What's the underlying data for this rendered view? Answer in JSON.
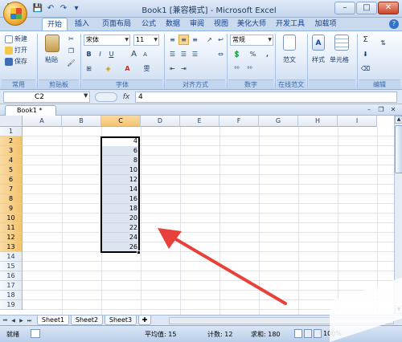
{
  "title": "Book1  [兼容模式] - Microsoft Excel",
  "window_controls": {
    "minimize": "–",
    "maximize": "□",
    "close": "✕"
  },
  "quick_access": [
    "save-icon",
    "undo-icon",
    "redo-icon",
    "customize-icon"
  ],
  "tabs": [
    "开始",
    "插入",
    "页面布局",
    "公式",
    "数据",
    "审阅",
    "视图",
    "美化大师",
    "开发工具",
    "加载项"
  ],
  "ribbon": {
    "groups": [
      "常用",
      "剪贴板",
      "字体",
      "对齐方式",
      "数字",
      "在线范文",
      "",
      "编辑"
    ],
    "common": {
      "new": "新建",
      "open": "打开",
      "save": "保存"
    },
    "clipboard": {
      "paste": "粘贴"
    },
    "font": {
      "name": "宋体",
      "size": "11",
      "bold": "B",
      "italic": "I",
      "underline": "U",
      "grow": "A",
      "shrink": "A"
    },
    "number": {
      "format": "常规",
      "percent": "%",
      "comma": ","
    },
    "fanwen": "范文",
    "styles": "样式",
    "cells": "单元格",
    "editing": {
      "sum": "Σ"
    }
  },
  "formula_bar": {
    "name_box": "C2",
    "fx": "fx",
    "value": "4"
  },
  "workbook": {
    "tab": "Book1 *"
  },
  "columns": [
    "A",
    "B",
    "C",
    "D",
    "E",
    "F",
    "G",
    "H",
    "I"
  ],
  "rows": [
    "1",
    "2",
    "3",
    "4",
    "5",
    "6",
    "7",
    "8",
    "9",
    "10",
    "11",
    "12",
    "13",
    "14",
    "15",
    "16",
    "17",
    "18",
    "19"
  ],
  "column_c_values": [
    "4",
    "6",
    "8",
    "10",
    "12",
    "14",
    "16",
    "18",
    "20",
    "22",
    "24",
    "26"
  ],
  "sheets": [
    "Sheet1",
    "Sheet2",
    "Sheet3"
  ],
  "status": {
    "mode": "就绪",
    "average": "平均值: 15",
    "count": "计数: 12",
    "sum": "求和: 180",
    "zoom": "100%"
  },
  "colors": {
    "accent": "#15428b",
    "selection": "#f3c36d",
    "arrow": "#e8413a"
  }
}
